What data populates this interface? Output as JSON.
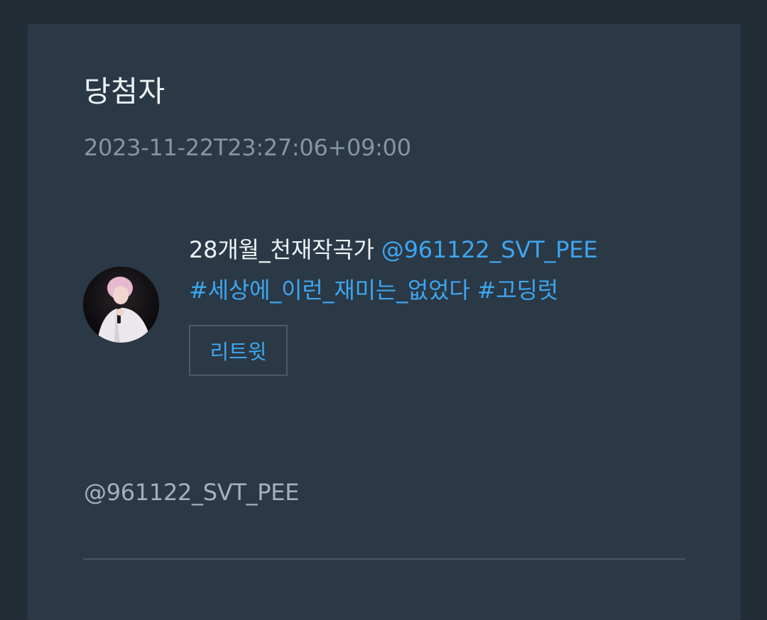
{
  "post": {
    "title": "당첨자",
    "timestamp": "2023-11-22T23:27:06+09:00"
  },
  "tweet": {
    "author": "28개월_천재작곡가",
    "mention": "@961122_SVT_PEE",
    "hashtag_1": "#세상에_이런_재미는_없었다",
    "hashtag_2": "#고딩럿",
    "retweet_label": "리트윗"
  },
  "footer": {
    "mention": "@961122_SVT_PEE"
  },
  "colors": {
    "background": "#222d36",
    "card": "#2a3945",
    "link": "#3ea5f0",
    "muted_text": "#8595a2"
  }
}
